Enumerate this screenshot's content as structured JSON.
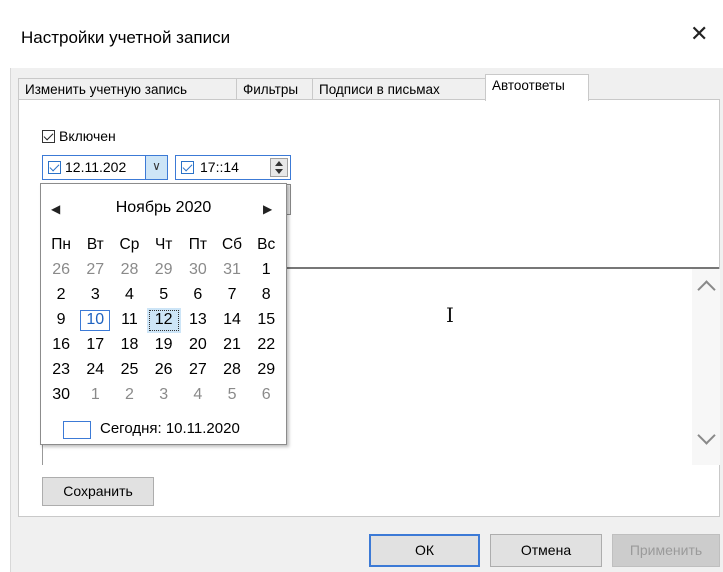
{
  "window": {
    "title": "Настройки учетной записи",
    "close_glyph": "✕"
  },
  "tabs": [
    {
      "label": "Изменить учетную запись"
    },
    {
      "label": "Фильтры"
    },
    {
      "label": "Подписи в письмах"
    },
    {
      "label": "Автоответы"
    }
  ],
  "autoreply": {
    "enabled_label": "Включен",
    "enabled_checked": true,
    "date_value": "12.11.202",
    "time_value": "17::14",
    "save_label": "Сохранить"
  },
  "calendar": {
    "month_label": "Ноябрь 2020",
    "weekdays": [
      "Пн",
      "Вт",
      "Ср",
      "Чт",
      "Пт",
      "Сб",
      "Вс"
    ],
    "weeks": [
      [
        "26",
        "27",
        "28",
        "29",
        "30",
        "31",
        "1"
      ],
      [
        "2",
        "3",
        "4",
        "5",
        "6",
        "7",
        "8"
      ],
      [
        "9",
        "10",
        "11",
        "12",
        "13",
        "14",
        "15"
      ],
      [
        "16",
        "17",
        "18",
        "19",
        "20",
        "21",
        "22"
      ],
      [
        "23",
        "24",
        "25",
        "26",
        "27",
        "28",
        "29"
      ],
      [
        "30",
        "1",
        "2",
        "3",
        "4",
        "5",
        "6"
      ]
    ],
    "today_label": "Сегодня: 10.11.2020"
  },
  "buttons": {
    "ok": "ОК",
    "cancel": "Отмена",
    "apply": "Применить"
  },
  "colors": {
    "accent": "#3c7ad6",
    "selected_bg": "#cde5f7"
  }
}
